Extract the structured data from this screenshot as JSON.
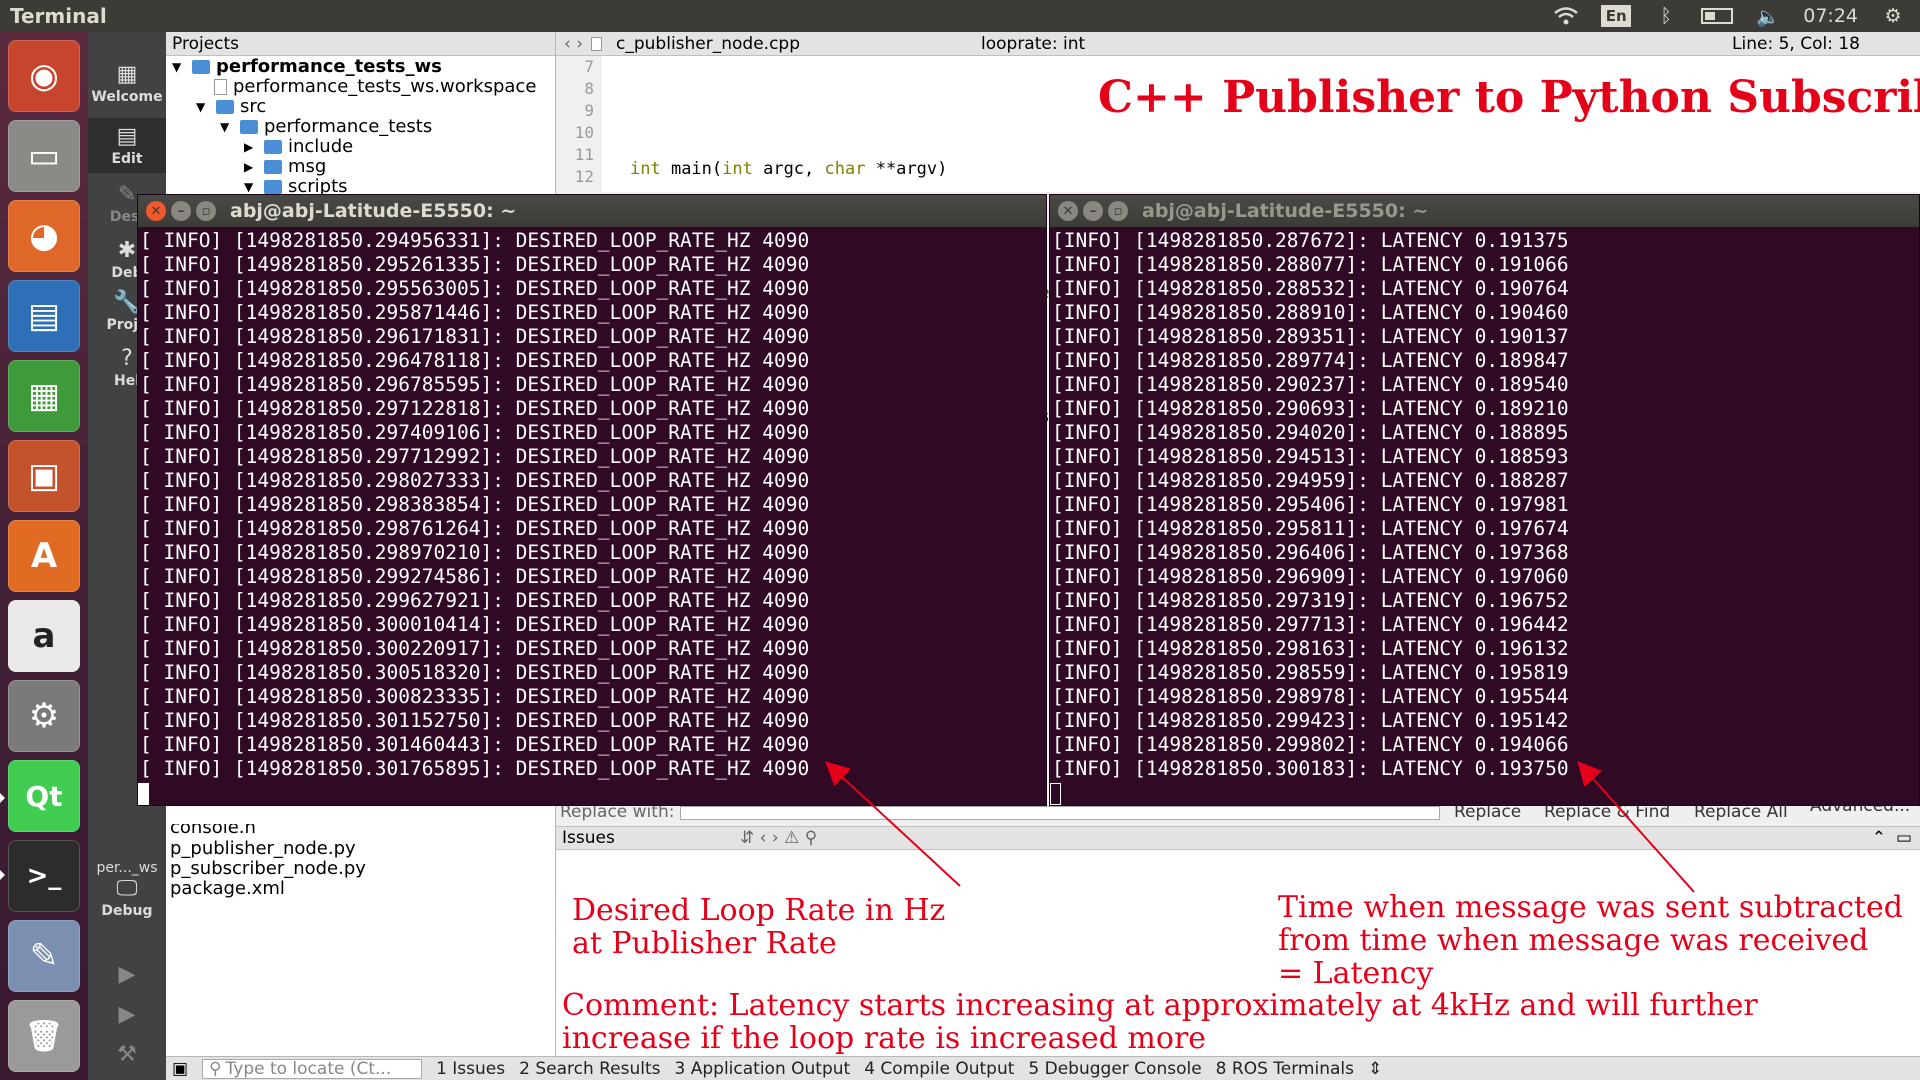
{
  "top_panel": {
    "app_title": "Terminal",
    "keyboard_layout": "En",
    "clock": "07:24"
  },
  "launcher": {
    "apps": [
      {
        "name": "ubuntu-dash",
        "glyph": "◉",
        "color": "#c7452c"
      },
      {
        "name": "files",
        "glyph": "▭",
        "color": "#8a8a86"
      },
      {
        "name": "firefox",
        "glyph": "◕",
        "color": "#e0672a"
      },
      {
        "name": "writer",
        "glyph": "▤",
        "color": "#2e6fb7"
      },
      {
        "name": "calc",
        "glyph": "▦",
        "color": "#3e9a3a"
      },
      {
        "name": "impress",
        "glyph": "▣",
        "color": "#c4522c"
      },
      {
        "name": "software-center",
        "glyph": "A",
        "color": "#e06a22"
      },
      {
        "name": "amazon",
        "glyph": "a",
        "color": "#e9e9e9"
      },
      {
        "name": "settings",
        "glyph": "⚙",
        "color": "#7a7a7a"
      },
      {
        "name": "qt-creator",
        "glyph": "Qt",
        "color": "#41cd52"
      },
      {
        "name": "terminal",
        "glyph": ">_",
        "color": "#2c2c2c"
      },
      {
        "name": "text-editor",
        "glyph": "✎",
        "color": "#7b8fb0"
      },
      {
        "name": "trash",
        "glyph": "🗑",
        "color": "#9a9a9a"
      }
    ]
  },
  "modebar": {
    "welcome": "Welcome",
    "edit": "Edit",
    "design": "Desi",
    "debug_short": "Deb",
    "projects": "Proje",
    "help": "Hel",
    "kit": "per..._ws",
    "debug": "Debug"
  },
  "projects_panel": {
    "header": "Projects",
    "tree": [
      {
        "label": "performance_tests_ws",
        "type": "project"
      },
      {
        "label": "performance_tests_ws.workspace",
        "type": "file"
      },
      {
        "label": "src",
        "type": "folder"
      },
      {
        "label": "performance_tests",
        "type": "folder"
      },
      {
        "label": "include",
        "type": "folder"
      },
      {
        "label": "msg",
        "type": "folder"
      },
      {
        "label": "scripts",
        "type": "folder"
      }
    ],
    "tree_bottom": [
      "console.h",
      "p_publisher_node.py",
      "p_subscriber_node.py",
      "package.xml"
    ]
  },
  "editor": {
    "filename": "c_publisher_node.cpp",
    "symbol": "looprate: int",
    "cursor_pos": "Line: 5, Col: 18",
    "line_numbers": [
      "7",
      "8",
      "9",
      "10",
      "11",
      "12"
    ]
  },
  "find_bar": {
    "replace_with_label": "Replace with:",
    "replace": "Replace",
    "replace_find": "Replace & Find",
    "replace_all": "Replace All",
    "advanced": "Advanced..."
  },
  "issues_pane": {
    "title": "Issues"
  },
  "status_bar": {
    "locate_placeholder": "Type to locate (Ct...",
    "tabs": [
      "1 Issues",
      "2 Search Results",
      "3 Application Output",
      "4 Compile Output",
      "5 Debugger Console",
      "8 ROS Terminals"
    ]
  },
  "terminal_left": {
    "title": "abj@abj-Latitude-E5550: ~",
    "lines": [
      "[ INFO] [1498281850.294956331]: DESIRED_LOOP_RATE_HZ 4090",
      "[ INFO] [1498281850.295261335]: DESIRED_LOOP_RATE_HZ 4090",
      "[ INFO] [1498281850.295563005]: DESIRED_LOOP_RATE_HZ 4090",
      "[ INFO] [1498281850.295871446]: DESIRED_LOOP_RATE_HZ 4090",
      "[ INFO] [1498281850.296171831]: DESIRED_LOOP_RATE_HZ 4090",
      "[ INFO] [1498281850.296478118]: DESIRED_LOOP_RATE_HZ 4090",
      "[ INFO] [1498281850.296785595]: DESIRED_LOOP_RATE_HZ 4090",
      "[ INFO] [1498281850.297122818]: DESIRED_LOOP_RATE_HZ 4090",
      "[ INFO] [1498281850.297409106]: DESIRED_LOOP_RATE_HZ 4090",
      "[ INFO] [1498281850.297712992]: DESIRED_LOOP_RATE_HZ 4090",
      "[ INFO] [1498281850.298027333]: DESIRED_LOOP_RATE_HZ 4090",
      "[ INFO] [1498281850.298383854]: DESIRED_LOOP_RATE_HZ 4090",
      "[ INFO] [1498281850.298761264]: DESIRED_LOOP_RATE_HZ 4090",
      "[ INFO] [1498281850.298970210]: DESIRED_LOOP_RATE_HZ 4090",
      "[ INFO] [1498281850.299274586]: DESIRED_LOOP_RATE_HZ 4090",
      "[ INFO] [1498281850.299627921]: DESIRED_LOOP_RATE_HZ 4090",
      "[ INFO] [1498281850.300010414]: DESIRED_LOOP_RATE_HZ 4090",
      "[ INFO] [1498281850.300220917]: DESIRED_LOOP_RATE_HZ 4090",
      "[ INFO] [1498281850.300518320]: DESIRED_LOOP_RATE_HZ 4090",
      "[ INFO] [1498281850.300823335]: DESIRED_LOOP_RATE_HZ 4090",
      "[ INFO] [1498281850.301152750]: DESIRED_LOOP_RATE_HZ 4090",
      "[ INFO] [1498281850.301460443]: DESIRED_LOOP_RATE_HZ 4090",
      "[ INFO] [1498281850.301765895]: DESIRED_LOOP_RATE_HZ 4090"
    ]
  },
  "terminal_right": {
    "title": "abj@abj-Latitude-E5550: ~",
    "lines": [
      "[INFO] [1498281850.287672]: LATENCY 0.191375",
      "[INFO] [1498281850.288077]: LATENCY 0.191066",
      "[INFO] [1498281850.288532]: LATENCY 0.190764",
      "[INFO] [1498281850.288910]: LATENCY 0.190460",
      "[INFO] [1498281850.289351]: LATENCY 0.190137",
      "[INFO] [1498281850.289774]: LATENCY 0.189847",
      "[INFO] [1498281850.290237]: LATENCY 0.189540",
      "[INFO] [1498281850.290693]: LATENCY 0.189210",
      "[INFO] [1498281850.294020]: LATENCY 0.188895",
      "[INFO] [1498281850.294513]: LATENCY 0.188593",
      "[INFO] [1498281850.294959]: LATENCY 0.188287",
      "[INFO] [1498281850.295406]: LATENCY 0.197981",
      "[INFO] [1498281850.295811]: LATENCY 0.197674",
      "[INFO] [1498281850.296406]: LATENCY 0.197368",
      "[INFO] [1498281850.296909]: LATENCY 0.197060",
      "[INFO] [1498281850.297319]: LATENCY 0.196752",
      "[INFO] [1498281850.297713]: LATENCY 0.196442",
      "[INFO] [1498281850.298163]: LATENCY 0.196132",
      "[INFO] [1498281850.298559]: LATENCY 0.195819",
      "[INFO] [1498281850.298978]: LATENCY 0.195544",
      "[INFO] [1498281850.299423]: LATENCY 0.195142",
      "[INFO] [1498281850.299802]: LATENCY 0.194066",
      "[INFO] [1498281850.300183]: LATENCY 0.193750"
    ]
  },
  "annotations": {
    "title": "C++ Publisher to Python Subscriber",
    "left_note_line1": "Desired Loop Rate in Hz",
    "left_note_line2": "at Publisher Rate",
    "right_note_line1": "Time when message was sent subtracted",
    "right_note_line2": "from time when message was received",
    "right_note_line3": "= Latency",
    "comment_line1": "Comment: Latency starts increasing at approximately at 4kHz and will further",
    "comment_line2": "increase if the loop rate is increased more",
    "accent_color": "#e5001a"
  }
}
